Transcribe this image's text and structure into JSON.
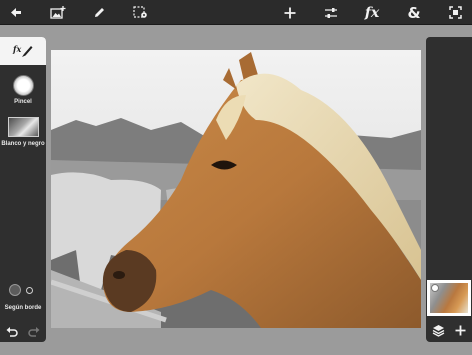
{
  "toolbar": {
    "items": [
      {
        "id": "back",
        "icon": "back-arrow-icon"
      },
      {
        "id": "add-image",
        "icon": "add-image-icon"
      },
      {
        "id": "edit",
        "icon": "pencil-icon"
      },
      {
        "id": "select",
        "icon": "selection-settings-icon"
      },
      {
        "id": "add",
        "icon": "plus-icon"
      },
      {
        "id": "adjust",
        "icon": "sliders-icon"
      },
      {
        "id": "effects",
        "icon": "fx-icon",
        "label": "fx"
      },
      {
        "id": "blend",
        "icon": "ampersand-icon",
        "label": "&"
      },
      {
        "id": "fullscreen",
        "icon": "fullscreen-icon"
      }
    ]
  },
  "left_panel": {
    "tab_label": "fx",
    "brush_label": "Pincel",
    "effect_label": "Blanco y negro",
    "edge_label": "Según borde"
  },
  "right_panel": {
    "layer_icon": "layers-icon",
    "add_icon": "plus-icon"
  },
  "colors": {
    "toolbar_bg": "#2b2b2b",
    "panel_bg": "#2f2f2f",
    "workspace_bg": "#9b9b9b",
    "icon": "#f2f2f2"
  }
}
